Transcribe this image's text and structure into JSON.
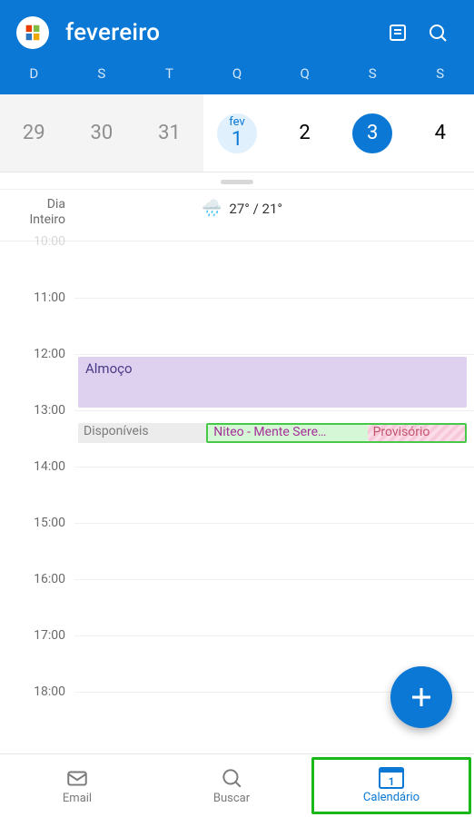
{
  "header": {
    "month": "fevereiro",
    "agenda_icon": "agenda-icon",
    "search_icon": "search-icon"
  },
  "dow": [
    "D",
    "S",
    "T",
    "Q",
    "Q",
    "S",
    "S"
  ],
  "dates": [
    {
      "num": "29",
      "prevMonth": true
    },
    {
      "num": "30",
      "prevMonth": true
    },
    {
      "num": "31",
      "prevMonth": true
    },
    {
      "num": "1",
      "mo": "fev",
      "today": true
    },
    {
      "num": "2"
    },
    {
      "num": "3",
      "selected": true
    },
    {
      "num": "4"
    }
  ],
  "allday": {
    "label_line1": "Dia",
    "label_line2": "Inteiro",
    "weather_icon": "🌧️",
    "temp_hi": "27°",
    "temp_lo": "21°"
  },
  "hours": [
    "10:00",
    "11:00",
    "12:00",
    "13:00",
    "14:00",
    "15:00",
    "16:00",
    "17:00",
    "18:00"
  ],
  "events": {
    "almoco": {
      "title": "Almoço"
    },
    "dispon": {
      "title": "Disponíveis"
    },
    "niteo": {
      "title": "Niteo - Mente Sere…"
    },
    "prov": {
      "title": "Provisório"
    }
  },
  "fab": {
    "label": "add-event"
  },
  "nav": {
    "email": {
      "label": "Email"
    },
    "buscar": {
      "label": "Buscar"
    },
    "cal": {
      "label": "Calendário",
      "day": "1"
    }
  }
}
